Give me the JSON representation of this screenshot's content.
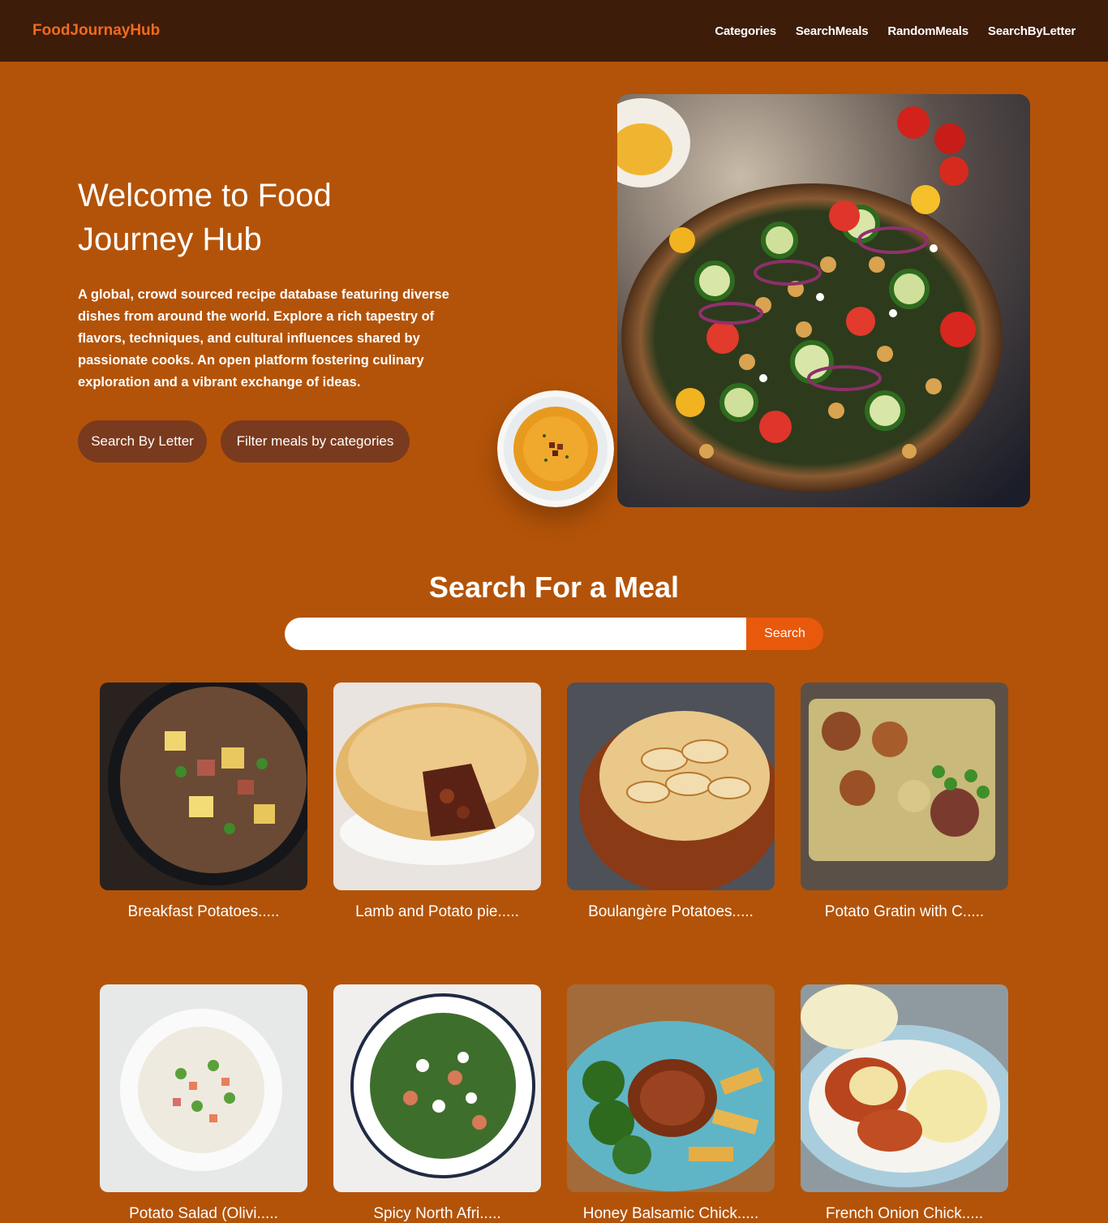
{
  "navbar": {
    "brand": "FoodJournayHub",
    "links": [
      "Categories",
      "SearchMeals",
      "RandomMeals",
      "SearchByLetter"
    ]
  },
  "hero": {
    "title": "Welcome to Food Journey Hub",
    "description": "A global, crowd sourced recipe database featuring diverse dishes from around the world. Explore a rich tapestry of flavors, techniques, and cultural influences shared by passionate cooks. An open platform fostering culinary exploration and a vibrant exchange of ideas.",
    "buttons": {
      "letter": "Search By Letter",
      "categories": "Filter meals by categories"
    }
  },
  "search": {
    "title": "Search For a Meal",
    "input_value": "",
    "button": "Search"
  },
  "meals": [
    {
      "title": "Breakfast Potatoes....."
    },
    {
      "title": "Lamb and Potato pie....."
    },
    {
      "title": "Boulangère Potatoes....."
    },
    {
      "title": "Potato Gratin with C....."
    },
    {
      "title": "Potato Salad (Olivi....."
    },
    {
      "title": "Spicy North Afri....."
    },
    {
      "title": "Honey Balsamic Chick....."
    },
    {
      "title": "French Onion Chick....."
    }
  ],
  "colors": {
    "page_bg": "#b35309",
    "navbar_bg": "#3d1c0a",
    "brand": "#f26a1b",
    "hero_button": "#7a3a1e",
    "search_button": "#e8590c"
  }
}
